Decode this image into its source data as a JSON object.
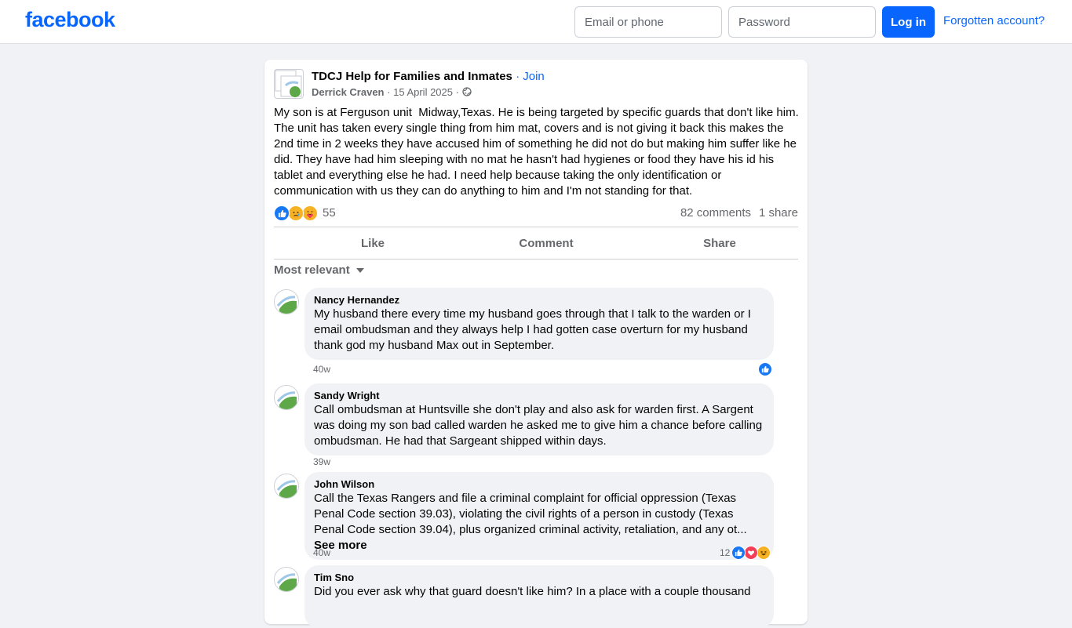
{
  "header": {
    "logo": "facebook",
    "email_placeholder": "Email or phone",
    "password_placeholder": "Password",
    "login_label": "Log in",
    "forgot_label": "Forgotten account?"
  },
  "post": {
    "group_name": "TDCJ Help for Families and Inmates",
    "separator": " · ",
    "join_label": "Join",
    "author": "Derrick Craven",
    "date": "15 April 2025",
    "visibility_icon": "globe-icon",
    "text": "My son is at Ferguson unit  Midway,Texas. He is being targeted by specific guards that don't like him. The unit has taken every single thing from him mat, covers and is not giving it back this makes the 2nd time in 2 weeks they have accused him of something he did not do but making him suffer like he did. They have had him sleeping with no mat he hasn't had hygienes or food they have his id his tablet and everything else he had. I need help because taking the only identification or communication with us they can do anything to him and I'm not standing for that.",
    "reaction_icons": [
      "like-icon",
      "sad-icon",
      "care-icon"
    ],
    "reaction_count": "55",
    "comments_count": "82 comments",
    "shares_count": "1 share",
    "actions": {
      "like": "Like",
      "comment": "Comment",
      "share": "Share"
    },
    "sort_label": "Most relevant"
  },
  "comments": [
    {
      "name": "Nancy Hernandez",
      "text": "My husband there every time my husband goes through that I talk to the warden or I email ombudsman and they always help I had gotten case overturn for my husband thank god my husband Max out in September.",
      "time": "40w",
      "reactions": [
        "like-icon"
      ],
      "reaction_count": ""
    },
    {
      "name": "Sandy Wright",
      "text": "Call ombudsman at Huntsville she don't play and also ask for warden first. A Sargent was doing my son bad called warden he asked me to give him a chance before calling ombudsman. He had that Sargeant shipped within days.",
      "time": "39w",
      "reactions": [],
      "reaction_count": ""
    },
    {
      "name": "John Wilson",
      "text": "Call the Texas Rangers and file a criminal complaint for official oppression (Texas Penal Code section 39.03), violating the civil rights of a person in custody (Texas Penal Code section 39.04), plus organized criminal activity, retaliation, and any ot...",
      "see_more": "See more",
      "time": "40w",
      "reactions": [
        "like-icon",
        "love-icon",
        "haha-icon"
      ],
      "reaction_count": "12"
    },
    {
      "name": "Tim Sno",
      "text": "Did you ever ask why that guard doesn't like him? In a place with a couple thousand",
      "time": "",
      "reactions": [],
      "reaction_count": ""
    }
  ],
  "colors": {
    "brand": "#0866ff",
    "like": "#1877f2",
    "love": "#f33e58",
    "care": "#f7b125",
    "sad": "#f7b125",
    "haha": "#f7b125",
    "background": "#f0f2f5"
  }
}
